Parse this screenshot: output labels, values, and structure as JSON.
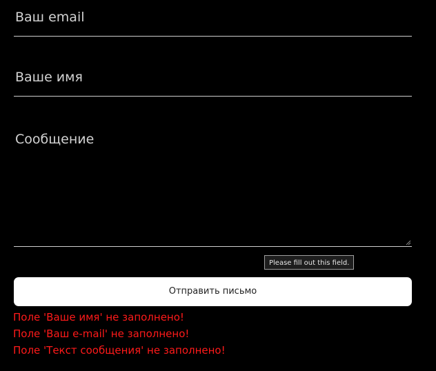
{
  "form": {
    "email_placeholder": "Ваш email",
    "name_placeholder": "Ваше имя",
    "message_placeholder": "Сообщение",
    "submit_label": "Отправить письмо"
  },
  "tooltip": {
    "text": "Please fill out this field."
  },
  "errors": [
    "Поле 'Ваше имя' не заполнено!",
    "Поле 'Ваш e-mail' не заполнено!",
    "Поле 'Текст сообщения' не заполнено!"
  ],
  "colors": {
    "background": "#000000",
    "field_text": "#d2d2d2",
    "field_border": "#cfcfcf",
    "button_bg": "#ffffff",
    "error": "#ff1a1a"
  }
}
